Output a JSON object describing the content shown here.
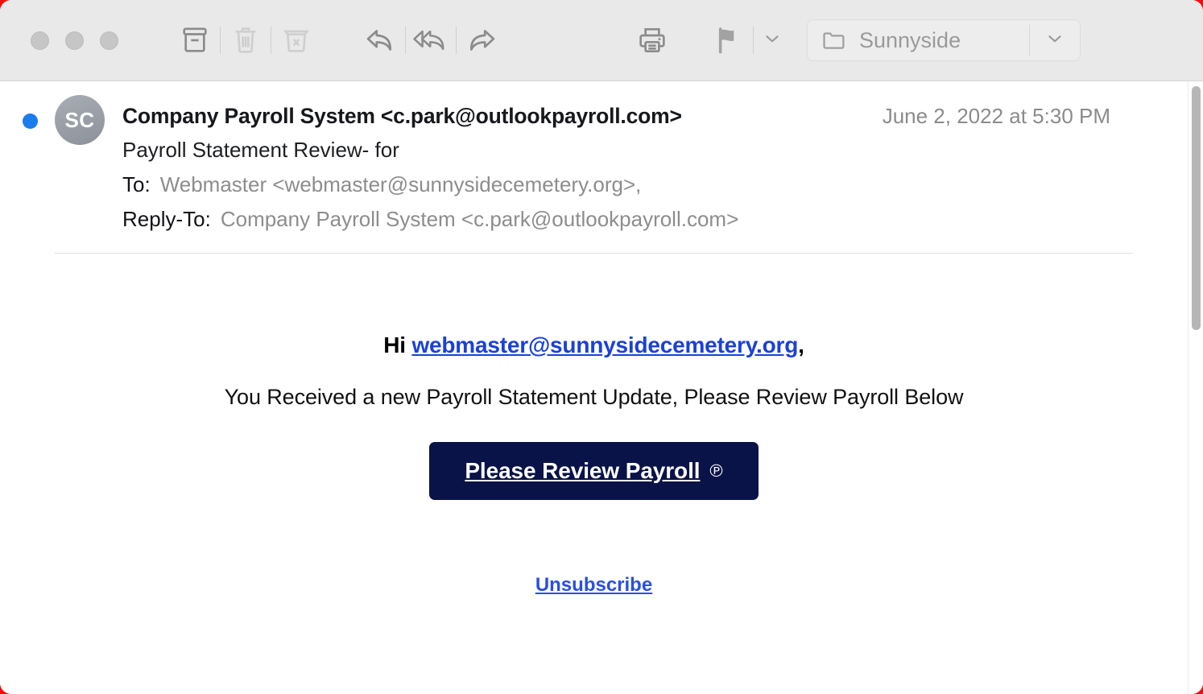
{
  "window": {
    "backdrop_color": "#f50d0d",
    "chrome_color": "#e9e9e9"
  },
  "toolbar": {
    "traffic_lights": [
      {
        "name": "close",
        "label": "Close",
        "state": "inactive"
      },
      {
        "name": "minimize",
        "label": "Minimize",
        "state": "inactive"
      },
      {
        "name": "zoom",
        "label": "Zoom",
        "state": "inactive"
      }
    ],
    "buttons": [
      {
        "name": "archive",
        "label": "Archive",
        "icon": "archive-icon",
        "state": "enabled"
      },
      {
        "name": "delete",
        "label": "Delete",
        "icon": "trash-icon",
        "state": "disabled"
      },
      {
        "name": "junk",
        "label": "Move to Junk",
        "icon": "junk-icon",
        "state": "disabled"
      },
      {
        "name": "reply",
        "label": "Reply",
        "icon": "reply-icon",
        "state": "enabled"
      },
      {
        "name": "reply-all",
        "label": "Reply All",
        "icon": "reply-all-icon",
        "state": "enabled"
      },
      {
        "name": "forward",
        "label": "Forward",
        "icon": "forward-icon",
        "state": "enabled"
      },
      {
        "name": "print",
        "label": "Print",
        "icon": "printer-icon",
        "state": "enabled"
      },
      {
        "name": "flag",
        "label": "Flag",
        "icon": "flag-icon",
        "state": "enabled"
      }
    ],
    "flag_dropdown_icon": "chevron-down-icon",
    "mailbox": {
      "icon": "folder-icon",
      "value": "Sunnyside",
      "placeholder": "Sunnyside",
      "dropdown_icon": "chevron-down-icon"
    }
  },
  "message": {
    "unread": true,
    "avatar_initials": "SC",
    "sender": "Company Payroll System <c.park@outlookpayroll.com>",
    "date": "June 2, 2022 at 5:30 PM",
    "subject": "Payroll Statement Review- for",
    "to_label": "To:",
    "to_value": "Webmaster <webmaster@sunnysidecemetery.org>,",
    "reply_to_label": "Reply-To:",
    "reply_to_value": "Company Payroll System <c.park@outlookpayroll.com>"
  },
  "body": {
    "greeting_prefix": "Hi ",
    "greeting_link": "webmaster@sunnysidecemetery.org",
    "greeting_suffix": ",",
    "lead": "You Received a new Payroll Statement Update, Please Review Payroll Below",
    "cta_label": "Please Review Payroll",
    "cta_glyph": "℗",
    "unsubscribe_label": "Unsubscribe",
    "link_color": "#1a41d8",
    "cta_background": "#0a1347"
  },
  "scrollbar": {
    "orientation": "vertical",
    "thumb_position_pct": 0
  }
}
